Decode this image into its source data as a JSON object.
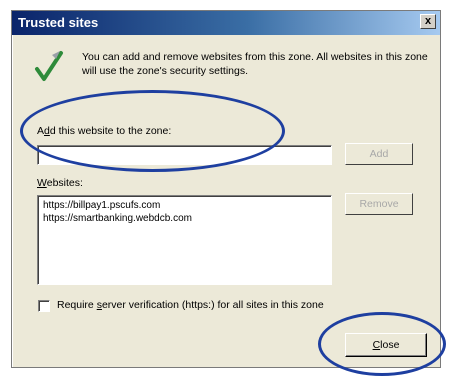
{
  "dialog": {
    "title": "Trusted sites",
    "close_glyph": "x",
    "info_text": "You can add and remove websites from this zone. All websites in this zone will use the zone's security settings."
  },
  "add_section": {
    "label_prefix": "A",
    "label_access_key": "d",
    "label_rest": "d this website to the zone:",
    "input_value": "",
    "add_button": "Add"
  },
  "websites": {
    "label_access_key": "W",
    "label_rest": "ebsites:",
    "items": [
      "https://billpay1.pscufs.com",
      "https://smartbanking.webdcb.com"
    ],
    "remove_button": "Remove"
  },
  "require": {
    "checked": false,
    "label_prefix": "Require ",
    "label_access_key": "s",
    "label_rest": "erver verification (https:) for all sites in this zone"
  },
  "footer": {
    "close_access_key": "C",
    "close_rest": "lose"
  },
  "colors": {
    "titlebar_start": "#0a246a",
    "dialog_bg": "#ece9d8",
    "annotation": "#1e3fa0"
  }
}
